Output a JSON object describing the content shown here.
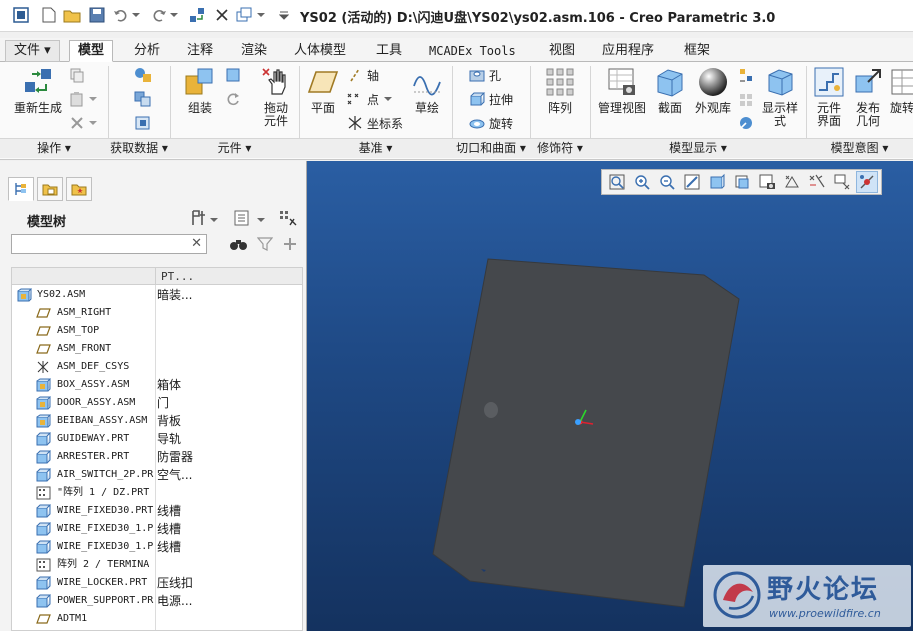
{
  "window": {
    "title": "YS02 (活动的) D:\\闪迪U盘\\YS02\\ys02.asm.106 - Creo Parametric 3.0"
  },
  "tabs": [
    {
      "label": "文件",
      "has_dropdown": true
    },
    {
      "label": "模型",
      "active": true
    },
    {
      "label": "分析"
    },
    {
      "label": "注释"
    },
    {
      "label": "渲染"
    },
    {
      "label": "人体模型"
    },
    {
      "label": "工具"
    },
    {
      "label": "MCADEx Tools"
    },
    {
      "label": "视图"
    },
    {
      "label": "应用程序"
    },
    {
      "label": "框架"
    }
  ],
  "ribbon": {
    "buttons": {
      "regenerate": "重新生成",
      "assemble": "组装",
      "drag": "拖动\n元件",
      "plane": "平面",
      "axis": "轴",
      "point": "点",
      "csys": "坐标系",
      "sketch": "草绘",
      "hole": "孔",
      "extrude": "拉伸",
      "revolve": "旋转",
      "pattern": "阵列",
      "manage_views": "管理视图",
      "section": "截面",
      "appearance": "外观库",
      "display_style": "显示样\n式",
      "component_interface": "元件\n界面",
      "publish_geometry": "发布\n几何",
      "more": "旋转"
    },
    "groups": [
      {
        "label": "操作 ▾"
      },
      {
        "label": "获取数据 ▾"
      },
      {
        "label": "元件 ▾"
      },
      {
        "label": "基准 ▾"
      },
      {
        "label": "切口和曲面 ▾"
      },
      {
        "label": "修饰符 ▾"
      },
      {
        "label": "模型显示 ▾"
      },
      {
        "label": "模型意图 ▾"
      }
    ]
  },
  "model_tree": {
    "title": "模型树",
    "search_value": "",
    "column_header": "PT...",
    "rows": [
      {
        "name": "YS02.ASM",
        "pt": "暗装...",
        "icon": "assembly-icon",
        "expander": "",
        "level": 0
      },
      {
        "name": "ASM_RIGHT",
        "pt": "",
        "icon": "datum-plane-icon",
        "expander": "",
        "level": 1
      },
      {
        "name": "ASM_TOP",
        "pt": "",
        "icon": "datum-plane-icon",
        "expander": "",
        "level": 1
      },
      {
        "name": "ASM_FRONT",
        "pt": "",
        "icon": "datum-plane-icon",
        "expander": "",
        "level": 1
      },
      {
        "name": "ASM_DEF_CSYS",
        "pt": "",
        "icon": "csys-icon",
        "expander": "",
        "level": 1
      },
      {
        "name": "BOX_ASSY.ASM",
        "pt": "箱体",
        "icon": "assembly-icon",
        "expander": "▶",
        "level": 1
      },
      {
        "name": "DOOR_ASSY.ASM",
        "pt": "门",
        "icon": "assembly-icon",
        "expander": "▶",
        "level": 1
      },
      {
        "name": "BEIBAN_ASSY.ASM",
        "pt": "背板",
        "icon": "assembly-icon",
        "expander": "▶",
        "level": 1
      },
      {
        "name": "GUIDEWAY.PRT",
        "pt": "导轨",
        "icon": "part-icon",
        "expander": "▶",
        "level": 1
      },
      {
        "name": "ARRESTER.PRT",
        "pt": "防雷器",
        "icon": "part-icon",
        "expander": "▶",
        "level": 1
      },
      {
        "name": "AIR_SWITCH_2P.PR",
        "pt": "空气...",
        "icon": "part-icon",
        "expander": "▶",
        "level": 1
      },
      {
        "name": "\"阵列 1 / DZ.PRT",
        "pt": "",
        "icon": "pattern-icon",
        "expander": "▶",
        "level": 1
      },
      {
        "name": "WIRE_FIXED30.PRT",
        "pt": "线槽",
        "icon": "part-icon",
        "expander": "▶",
        "level": 1
      },
      {
        "name": "WIRE_FIXED30_1.P",
        "pt": "线槽",
        "icon": "part-icon",
        "expander": "▶",
        "level": 1
      },
      {
        "name": "WIRE_FIXED30_1.P",
        "pt": "线槽",
        "icon": "part-icon",
        "expander": "▶",
        "level": 1
      },
      {
        "name": "阵列 2 / TERMINA",
        "pt": "",
        "icon": "pattern-icon",
        "expander": "▶",
        "level": 1
      },
      {
        "name": "WIRE_LOCKER.PRT",
        "pt": "压线扣",
        "icon": "part-icon",
        "expander": "▶",
        "level": 1
      },
      {
        "name": "POWER_SUPPORT.PR",
        "pt": "电源...",
        "icon": "part-icon",
        "expander": "▶",
        "level": 1
      },
      {
        "name": "ADTM1",
        "pt": "",
        "icon": "datum-plane-icon",
        "expander": "",
        "level": 1
      }
    ]
  },
  "watermark": {
    "text": "野火论坛",
    "url": "www.proewildfire.cn"
  },
  "colors": {
    "viewport_top": "#2a5ea3",
    "viewport_bottom": "#14325f",
    "model_body": "#45484c",
    "accent_blue": "#3a6fb0"
  }
}
